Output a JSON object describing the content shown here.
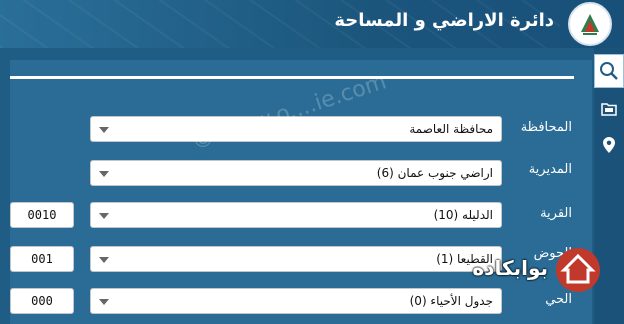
{
  "header": {
    "title": "دائرة الاراضي و المساحة"
  },
  "sidebar": {
    "items": [
      {
        "icon": "search-icon"
      },
      {
        "icon": "folder-icon"
      },
      {
        "icon": "location-pin-icon"
      }
    ]
  },
  "form": {
    "governorate": {
      "label": "المحافظة",
      "value": "محافظة العاصمة"
    },
    "directorate": {
      "label": "المديرية",
      "value": "اراضي جنوب عمان (6)"
    },
    "village": {
      "label": "القرية",
      "value": "الدليله (10)",
      "code": "0010"
    },
    "basin": {
      "label": "الحوض",
      "value": "القطيعا (1)",
      "code": "001"
    },
    "neighborhood": {
      "label": "الحي",
      "value": "جدول الأحياء (0)",
      "code": "000"
    }
  },
  "watermark": "© www.o....ie.com",
  "brand": {
    "name": "بوابكاده"
  }
}
